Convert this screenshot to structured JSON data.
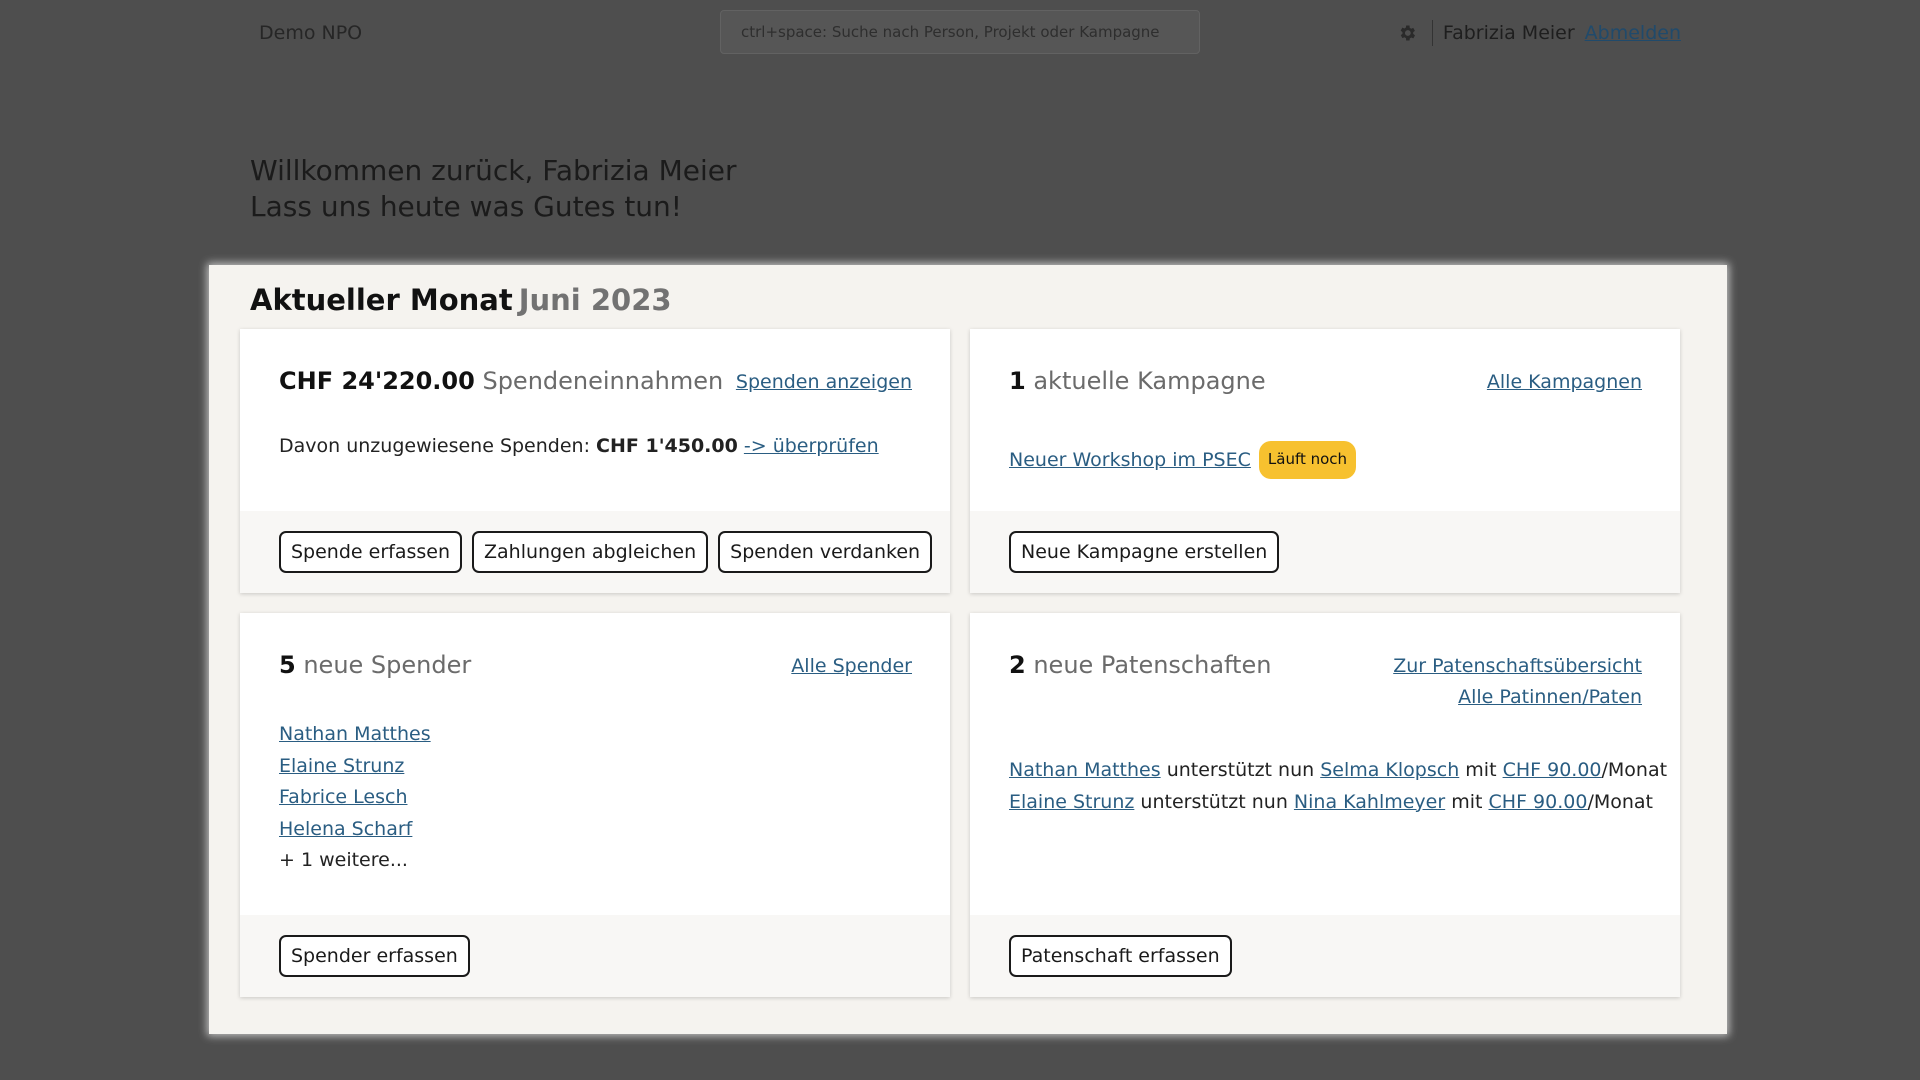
{
  "topbar": {
    "brand": "Demo NPO",
    "search_placeholder": "ctrl+space: Suche nach Person, Projekt oder Kampagne",
    "user_name": "Fabrizia Meier",
    "logout_label": "Abmelden"
  },
  "welcome": {
    "line1": "Willkommen zurück, Fabrizia Meier",
    "line2": "Lass uns heute was Gutes tun!"
  },
  "panel": {
    "title": "Aktueller Monat",
    "month": "Juni 2023"
  },
  "donations": {
    "amount": "CHF 24'220.00",
    "label": "Spendeneinnahmen",
    "link": "Spenden anzeigen",
    "unassigned_prefix": "Davon unzugewiesene Spenden:",
    "unassigned_amount": "CHF 1'450.00",
    "review_link": "-> überprüfen",
    "buttons": [
      "Spende erfassen",
      "Zahlungen abgleichen",
      "Spenden verdanken"
    ]
  },
  "campaigns": {
    "count": "1",
    "label": "aktuelle Kampagne",
    "link": "Alle Kampagnen",
    "items": [
      {
        "name": "Neuer Workshop im PSEC",
        "status": "Läuft noch"
      }
    ],
    "button": "Neue Kampagne erstellen"
  },
  "donors": {
    "count": "5",
    "label": "neue Spender",
    "link": "Alle Spender",
    "items": [
      "Nathan Matthes",
      "Elaine Strunz",
      "Fabrice Lesch",
      "Helena Scharf"
    ],
    "more": "+ 1 weitere...",
    "button": "Spender erfassen"
  },
  "sponsorships": {
    "count": "2",
    "label": "neue Patenschaften",
    "link_overview": "Zur Patenschaftsübersicht",
    "link_all": "Alle Patinnen/Paten",
    "connector_supports": "unterstützt nun",
    "connector_with": "mit",
    "per_month": "/Monat",
    "items": [
      {
        "sponsor": "Nathan Matthes",
        "child": "Selma Klopsch",
        "amount": "CHF 90.00"
      },
      {
        "sponsor": "Elaine Strunz",
        "child": "Nina Kahlmeyer",
        "amount": "CHF 90.00"
      }
    ],
    "button": "Patenschaft erfassen"
  },
  "icons": {
    "settings": "gear-icon"
  },
  "colors": {
    "page_background": "#4e4e4e",
    "panel_background": "#f5f3ef",
    "link": "#2a5d82",
    "badge": "#f7c12f"
  }
}
